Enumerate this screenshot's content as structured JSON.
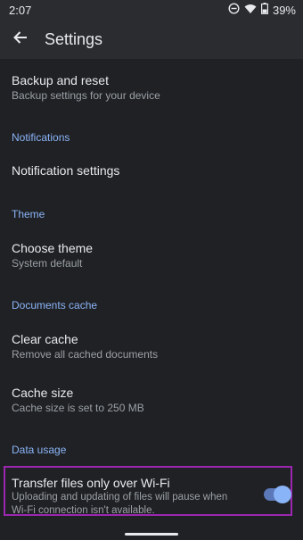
{
  "status_bar": {
    "time": "2:07",
    "battery": "39%",
    "icons": [
      "dnd-icon",
      "wifi-icon",
      "battery-icon"
    ]
  },
  "app_bar": {
    "title": "Settings",
    "back_icon": "arrow-back-icon"
  },
  "sections": {
    "backup": {
      "title": "Backup and reset",
      "subtitle": "Backup settings for your device"
    },
    "notifications_header": "Notifications",
    "notification_settings": {
      "title": "Notification settings"
    },
    "theme_header": "Theme",
    "choose_theme": {
      "title": "Choose theme",
      "subtitle": "System default"
    },
    "documents_header": "Documents cache",
    "clear_cache": {
      "title": "Clear cache",
      "subtitle": "Remove all cached documents"
    },
    "cache_size": {
      "title": "Cache size",
      "subtitle": "Cache size is set to 250 MB"
    },
    "data_usage_header": "Data usage",
    "wifi_only": {
      "title": "Transfer files only over Wi-Fi",
      "subtitle_line1": "Uploading and updating of files will pause when",
      "subtitle_line2": "Wi-Fi connection isn't available.",
      "enabled": true
    }
  },
  "colors": {
    "background": "#202124",
    "accent": "#8ab4f8",
    "highlight_border": "#9b27b0"
  }
}
